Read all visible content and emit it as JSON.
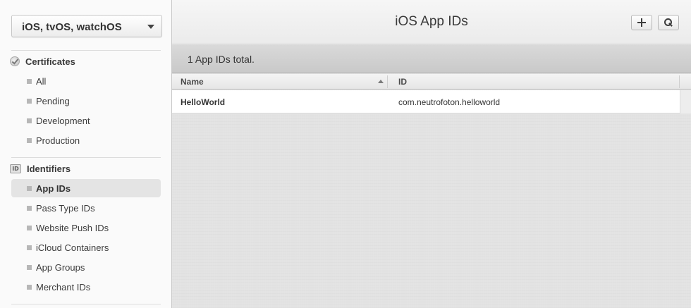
{
  "sidebar": {
    "platform": "iOS, tvOS, watchOS",
    "certificates": {
      "title": "Certificates",
      "items": [
        "All",
        "Pending",
        "Development",
        "Production"
      ]
    },
    "identifiers": {
      "title": "Identifiers",
      "icon_text": "ID",
      "items": [
        "App IDs",
        "Pass Type IDs",
        "Website Push IDs",
        "iCloud Containers",
        "App Groups",
        "Merchant IDs"
      ],
      "active": "App IDs"
    }
  },
  "header": {
    "title": "iOS App IDs",
    "add_icon": "plus-icon",
    "search_icon": "search-icon"
  },
  "summary": {
    "count_text": "1  App IDs total."
  },
  "table": {
    "columns": [
      "Name",
      "ID"
    ],
    "rows": [
      {
        "name": "HelloWorld",
        "id": "com.neutrofoton.helloworld"
      }
    ]
  }
}
